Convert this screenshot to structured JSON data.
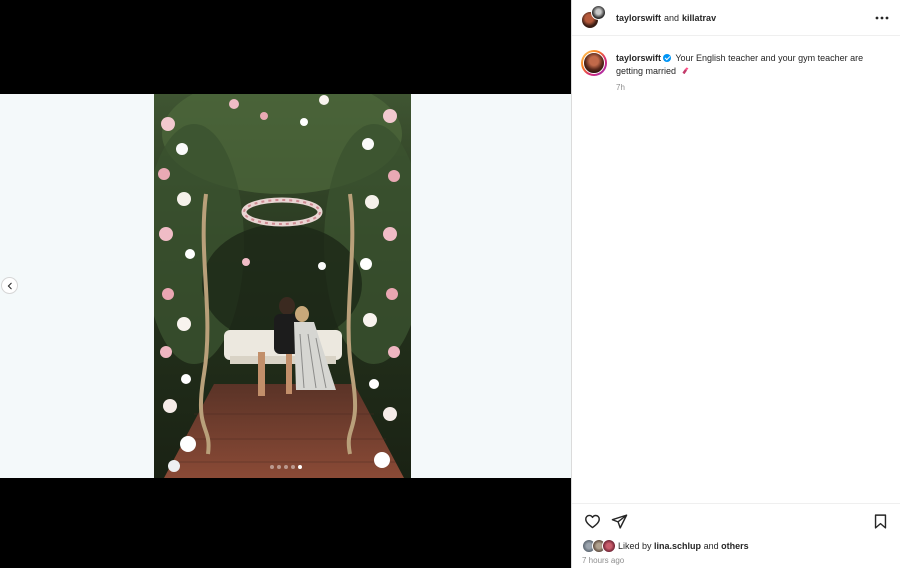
{
  "header": {
    "user1": "taylorswift",
    "conjunction": "and",
    "user2": "killatrav",
    "more_icon": "more-horizontal-icon"
  },
  "caption": {
    "username": "taylorswift",
    "verified_icon": "verified-badge-icon",
    "text": "Your English teacher and your gym teacher are getting married",
    "emoji_icon": "lipstick-icon",
    "time": "7h"
  },
  "media": {
    "prev_icon": "chevron-left-icon",
    "carousel_count": 5,
    "carousel_active_index": 5
  },
  "actions": {
    "like_icon": "heart-icon",
    "share_icon": "paper-plane-icon",
    "save_icon": "bookmark-icon"
  },
  "likes": {
    "prefix": "Liked by",
    "user": "lina.schlup",
    "conjunction": "and",
    "others": "others"
  },
  "post_time": "7 hours ago",
  "colors": {
    "verified": "#0095f6",
    "muted": "#8e8e8e",
    "text": "#262626",
    "stage_background": "#f4f9fa"
  }
}
